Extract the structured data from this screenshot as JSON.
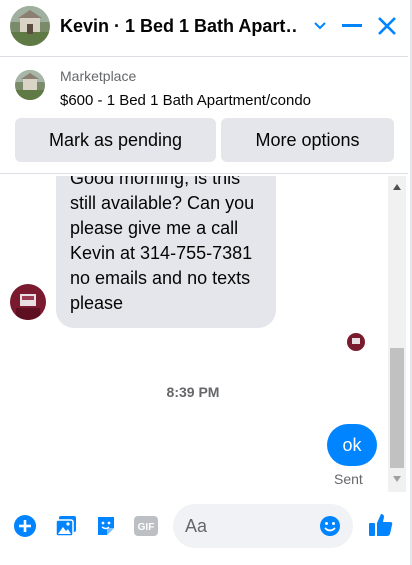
{
  "header": {
    "title": "Kevin · 1 Bed 1 Bath Apart…",
    "icons": [
      "avatar",
      "chevron-down-icon",
      "minimize-icon",
      "close-icon"
    ]
  },
  "listing": {
    "label": "Marketplace",
    "text": "$600 - 1 Bed 1 Bath Apartment/condo"
  },
  "actions": {
    "pending_label": "Mark as pending",
    "more_label": "More options"
  },
  "thread": {
    "incoming": {
      "line1": "Good morning, is this",
      "line2": "still available? Can you",
      "line3": "please give me a call",
      "line4": "Kevin at 314-755-7381",
      "line5": "no emails and no texts",
      "line6": "please"
    },
    "timestamp": "8:39 PM",
    "outgoing": "ok",
    "status": "Sent"
  },
  "composer": {
    "placeholder": "Aa",
    "icons": [
      "plus-icon",
      "photo-icon",
      "sticker-icon",
      "gif-icon",
      "emoji-icon",
      "like-icon"
    ],
    "gif_label": "GIF"
  },
  "colors": {
    "accent": "#0084ff",
    "bubble_gray": "#e4e6eb",
    "secondary_text": "#65676b"
  }
}
